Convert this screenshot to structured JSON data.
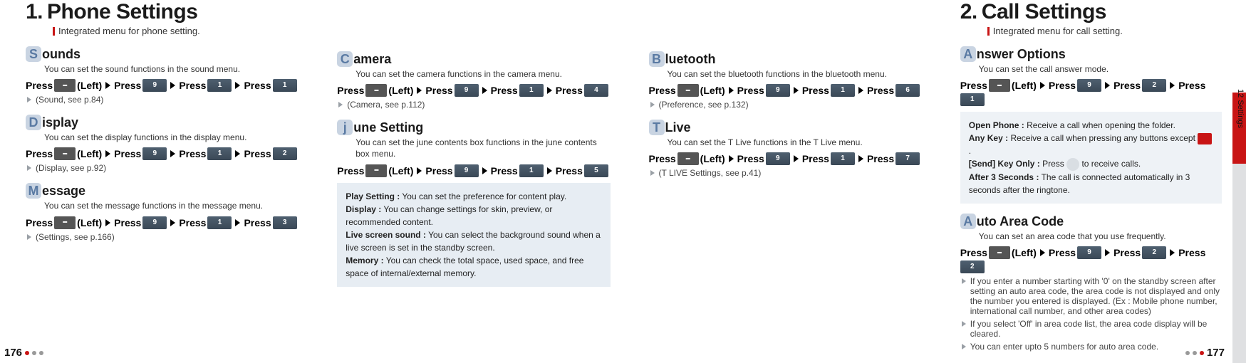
{
  "left": {
    "page_num": "176",
    "h1_num": "1.",
    "h1_title": "Phone Settings",
    "tagline": "Integrated menu for phone setting.",
    "columns": {
      "a": {
        "sounds": {
          "cap": "S",
          "title": "ounds",
          "desc": "You can set the sound functions in the sound menu.",
          "press": [
            "Press",
            "menu",
            "(Left)",
            "▶",
            "Press",
            "9",
            "▶",
            "Press",
            "1",
            "▶",
            "Press",
            "1"
          ],
          "ref": "(Sound, see p.84)"
        },
        "display": {
          "cap": "D",
          "title": "isplay",
          "desc": "You can set the display functions in the display menu.",
          "press": [
            "Press",
            "menu",
            "(Left)",
            "▶",
            "Press",
            "9",
            "▶",
            "Press",
            "1",
            "▶",
            "Press",
            "2"
          ],
          "ref": "(Display, see p.92)"
        },
        "message": {
          "cap": "M",
          "title": "essage",
          "desc": "You can set the message functions in the message menu.",
          "press": [
            "Press",
            "menu",
            "(Left)",
            "▶",
            "Press",
            "9",
            "▶",
            "Press",
            "1",
            "▶",
            "Press",
            "3"
          ],
          "ref": "(Settings, see p.166)"
        }
      },
      "b": {
        "camera": {
          "cap": "C",
          "title": "amera",
          "desc": "You can set the camera functions in the camera menu.",
          "press": [
            "Press",
            "menu",
            "(Left)",
            "▶",
            "Press",
            "9",
            "▶",
            "Press",
            "1",
            "▶",
            "Press",
            "4"
          ],
          "ref": "(Camera, see p.112)"
        },
        "june": {
          "cap": "j",
          "title": "une Setting",
          "desc": "You can set the june contents box functions in the june contents box menu.",
          "press": [
            "Press",
            "menu",
            "(Left)",
            "▶",
            "Press",
            "9",
            "▶",
            "Press",
            "1",
            "▶",
            "Press",
            "5"
          ]
        },
        "notebox": {
          "play_l": "Play Setting :",
          "play_v": "You can set the preference for content play.",
          "disp_l": "Display :",
          "disp_v": "You can change settings for skin, preview, or recommended content.",
          "lss_l": "Live screen sound :",
          "lss_v": "You can select the background sound when a live screen is set in the standby screen.",
          "mem_l": "Memory :",
          "mem_v": "You can check the total space, used space, and free space of internal/external memory."
        }
      },
      "c": {
        "bluetooth": {
          "cap": "B",
          "title": "luetooth",
          "desc": "You can set the bluetooth functions in the bluetooth menu.",
          "press": [
            "Press",
            "menu",
            "(Left)",
            "▶",
            "Press",
            "9",
            "▶",
            "Press",
            "1",
            "▶",
            "Press",
            "6"
          ],
          "ref": "(Preference, see p.132)"
        },
        "tlive": {
          "cap": "T",
          "title": "Live",
          "desc": "You can set the T Live functions in the T Live menu.",
          "press": [
            "Press",
            "menu",
            "(Left)",
            "▶",
            "Press",
            "9",
            "▶",
            "Press",
            "1",
            "▶",
            "Press",
            "7"
          ],
          "ref": "(T LIVE Settings, see p.41)"
        }
      }
    }
  },
  "right": {
    "page_num": "177",
    "side_tab_label": "12  Settings",
    "h1_num": "2.",
    "h1_title": "Call Settings",
    "tagline": "Integrated menu for call setting.",
    "answer": {
      "cap": "A",
      "title": "nswer Options",
      "desc": "You can set the call answer mode.",
      "press": [
        "Press",
        "menu",
        "(Left)",
        "▶",
        "Press",
        "9",
        "▶",
        "Press",
        "2",
        "▶",
        "Press",
        "1"
      ]
    },
    "answer_box": {
      "open_l": "Open Phone :",
      "open_v": "Receive a call when opening the folder.",
      "any_l": "Any Key :",
      "any_v_pre": "Receive a call when pressing any buttons except ",
      "any_v_post": ".",
      "send_l": "[Send] Key Only :",
      "send_v_pre": "Press ",
      "send_v_post": " to receive calls.",
      "after_l": "After 3 Seconds :",
      "after_v": "The call is connected automatically in 3 seconds after the ringtone."
    },
    "area": {
      "cap": "A",
      "title": "uto Area Code",
      "desc": "You can set an area code that you use frequently.",
      "press": [
        "Press",
        "menu",
        "(Left)",
        "▶",
        "Press",
        "9",
        "▶",
        "Press",
        "2",
        "▶",
        "Press",
        "2"
      ],
      "n1": "If you enter a number starting with '0' on the standby screen after setting an auto area code, the area code is not displayed and only the number you entered is displayed. (Ex : Mobile phone number, international call number, and other area codes)",
      "n2": "If you select 'Off' in  area code list, the area code display will be cleared.",
      "n3": "You can enter upto 5 numbers for auto area code."
    }
  }
}
